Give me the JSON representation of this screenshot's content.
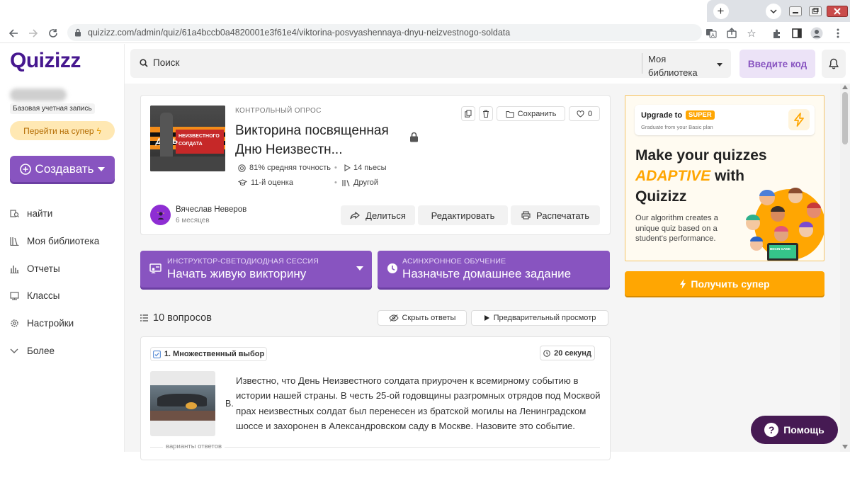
{
  "browser": {
    "url": "quizizz.com/admin/quiz/61a4bccb0a4820001e3f61e4/viktorina-posvyashennaya-dnyu-neizvestnogo-soldata"
  },
  "sidebar": {
    "logo": "Quizizz",
    "account_type": "Базовая учетная запись",
    "upgrade_label": "Перейти на супер",
    "create_label": "Создавать",
    "nav": [
      {
        "label": "найти",
        "icon": "search-grid-icon"
      },
      {
        "label": "Моя библиотека",
        "icon": "library-icon"
      },
      {
        "label": "Отчеты",
        "icon": "reports-icon"
      },
      {
        "label": "Классы",
        "icon": "classes-icon"
      },
      {
        "label": "Настройки",
        "icon": "gear-icon"
      },
      {
        "label": "Более",
        "icon": "chevron-down-icon"
      }
    ]
  },
  "topbar": {
    "search_placeholder": "Поиск",
    "library_dropdown": "Моя библиотека",
    "enter_code": "Введите код"
  },
  "quiz": {
    "kind": "КОНТРОЛЬНЫЙ ОПРОС",
    "title_line1": "Викторина посвященная",
    "title_line2": "Дню Неизвестн...",
    "accuracy": "81% средняя точность",
    "plays": "14 пьесы",
    "grade": "11-й оценка",
    "subject": "Другой",
    "save_label": "Сохранить",
    "likes": "0",
    "author_name": "Вячеслав Неверов",
    "author_time": "6 месяцев",
    "share_label": "Делиться",
    "edit_label": "Редактировать",
    "print_label": "Распечатать",
    "cover_text_1": "ДЕНЬ",
    "cover_text_2": "НЕИЗВЕСТНОГО",
    "cover_text_3": "СОЛДАТА"
  },
  "actions": {
    "live_tag": "ИНСТРУКТОР-СВЕТОДИОДНАЯ СЕССИЯ",
    "live_label": "Начать живую викторину",
    "hw_tag": "АСИНХРОННОЕ ОБУЧЕНИЕ",
    "hw_label": "Назначьте домашнее задание"
  },
  "questions": {
    "count_label": "10 вопросов",
    "hide_answers": "Скрыть ответы",
    "preview": "Предварительный просмотр",
    "items": [
      {
        "type": "1. Множественный выбор",
        "time": "20 секунд",
        "prefix": "В.",
        "text": "Известно, что День Неизвестного солдата приурочен к всемирному событию в истории нашей страны. В честь 25-ой годовщины разгромных отрядов под Москвой прах неизвестных солдат был перенесен из братской могилы на Ленинградском шоссе и захоронен в Александровском саду в Москве. Назовите это событие.",
        "answers_label": "варианты ответов"
      }
    ]
  },
  "ad": {
    "upgrade_to": "Upgrade to",
    "super_badge": "SUPER",
    "graduate": "Graduate from your Basic plan",
    "headline1": "Make your quizzes",
    "headline2a": "ADAPTIVE",
    "headline2b": " with",
    "headline3": "Quizizz",
    "body": "Our algorithm creates a unique quiz based on a student's performance.",
    "screen_label": "BEGIN GAME"
  },
  "get_super": "Получить супер",
  "help": "Помощь",
  "colors": {
    "brand": "#8854c0",
    "logo": "#46178f",
    "super": "#ffa602",
    "help": "#461a53"
  }
}
